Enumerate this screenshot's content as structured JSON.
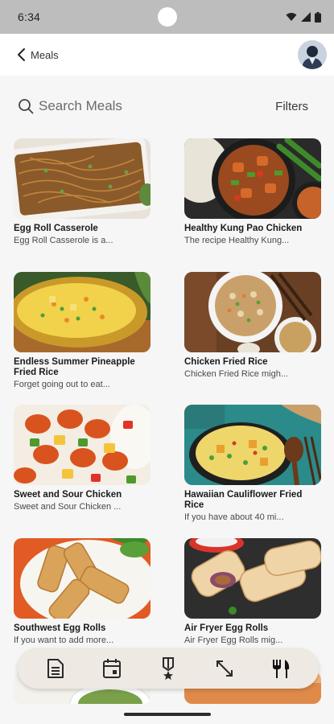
{
  "status_bar": {
    "time": "6:34",
    "icons": [
      "wifi-icon",
      "signal-icon",
      "battery-icon"
    ]
  },
  "app_bar": {
    "back_label": "Meals",
    "avatar": "user-avatar"
  },
  "search": {
    "placeholder": "Search Meals",
    "filters_label": "Filters"
  },
  "meals": [
    {
      "title": "Egg Roll Casserole",
      "description": "Egg Roll Casserole is a..."
    },
    {
      "title": "Healthy Kung Pao Chicken",
      "description": "The recipe Healthy Kung..."
    },
    {
      "title": "Endless Summer Pineapple Fried Rice",
      "description": "Forget going out to eat..."
    },
    {
      "title": "Chicken Fried Rice",
      "description": "Chicken Fried Rice migh..."
    },
    {
      "title": "Sweet and Sour Chicken",
      "description": "Sweet and Sour Chicken ..."
    },
    {
      "title": "Hawaiian Cauliflower Fried Rice",
      "description": "If you have about 40 mi..."
    },
    {
      "title": "Southwest Egg Rolls",
      "description": "If you want to add more..."
    },
    {
      "title": "Air Fryer Egg Rolls",
      "description": "Air Fryer Egg Rolls mig..."
    }
  ],
  "bottom_nav": {
    "items": [
      "document-icon",
      "calendar-icon",
      "medal-icon",
      "expand-arrows-icon",
      "utensils-icon"
    ]
  },
  "colors": {
    "status_bar": "#bdbdbd",
    "background": "#f6f6f6",
    "nav_background": "#efe9e4"
  }
}
